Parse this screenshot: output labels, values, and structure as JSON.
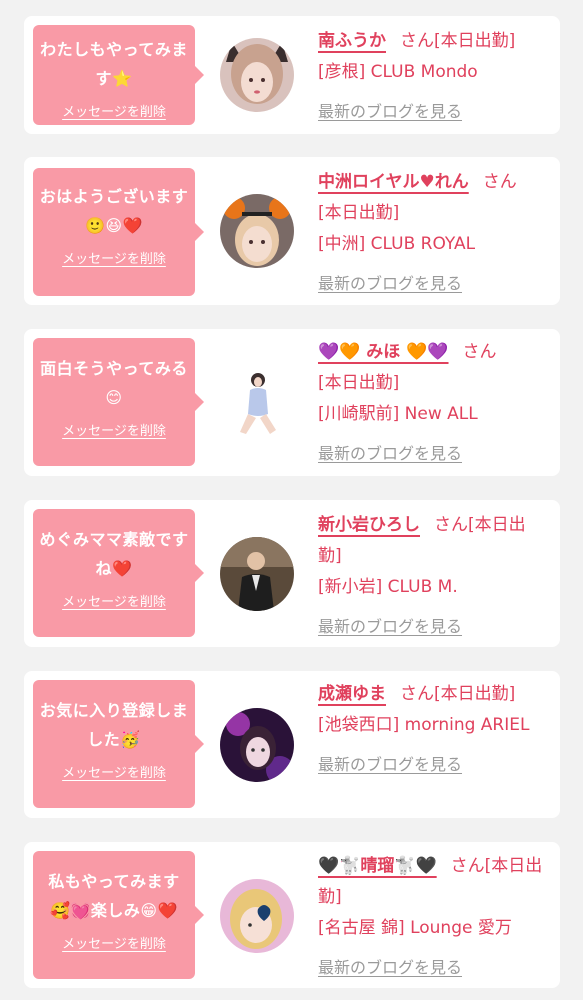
{
  "theme": {
    "bubble_bg": "#f99aa6",
    "accent": "#e0415d",
    "muted": "#9a9a9a",
    "page_bg": "#f2f2f2"
  },
  "items": [
    {
      "message": "わたしもやってみます⭐",
      "delete_label": "メッセージを削除",
      "name": "南ふうか",
      "san": "さん",
      "status": "[本日出勤]",
      "shop": "[彦根] CLUB Mondo",
      "blog_label": "最新のブログを見る",
      "avatar_icon": "cat-ear-girl-avatar"
    },
    {
      "message": "おはようございます🙂😆❤️",
      "delete_label": "メッセージを削除",
      "name": "中洲ロイヤル♥れん",
      "san": "さん",
      "status": "[本日出勤]",
      "shop": "[中洲] CLUB ROYAL",
      "blog_label": "最新のブログを見る",
      "avatar_icon": "pumpkin-headband-avatar"
    },
    {
      "message": "面白そうやってみる😊",
      "delete_label": "メッセージを削除",
      "name": "💜🧡 みほ 🧡💜",
      "san": "さん",
      "status": "[本日出勤]",
      "shop": "[川崎駅前] New ALL",
      "blog_label": "最新のブログを見る",
      "avatar_icon": "seated-woman-avatar"
    },
    {
      "message": "めぐみママ素敵ですね❤️",
      "delete_label": "メッセージを削除",
      "name": "新小岩ひろし",
      "san": "さん",
      "status": "[本日出勤]",
      "shop": "[新小岩] CLUB M.",
      "blog_label": "最新のブログを見る",
      "avatar_icon": "man-in-suit-avatar"
    },
    {
      "message": "お気に入り登録しました🥳",
      "delete_label": "メッセージを削除",
      "name": "成瀬ゆま",
      "san": "さん",
      "status": "[本日出勤]",
      "shop": "[池袋西口] morning ARIEL",
      "blog_label": "最新のブログを見る",
      "avatar_icon": "purple-light-avatar"
    },
    {
      "message": "私もやってみます🥰💓楽しみ😁❤️",
      "delete_label": "メッセージを削除",
      "name": "🖤🐩晴瑠🐩🖤",
      "san": "さん",
      "status": "[本日出勤]",
      "shop": "[名古屋 錦] Lounge 愛万",
      "blog_label": "最新のブログを見る",
      "avatar_icon": "blonde-heart-avatar"
    }
  ]
}
